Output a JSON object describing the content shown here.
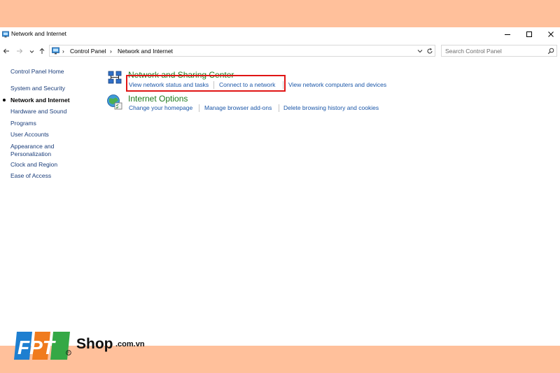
{
  "window": {
    "title": "Network and Internet"
  },
  "address": {
    "crumbs": [
      "Control Panel",
      "Network and Internet"
    ],
    "search_placeholder": "Search Control Panel"
  },
  "sidebar": {
    "home": "Control Panel Home",
    "items": [
      {
        "label": "System and Security"
      },
      {
        "label": "Network and Internet",
        "current": true
      },
      {
        "label": "Hardware and Sound"
      },
      {
        "label": "Programs"
      },
      {
        "label": "User Accounts"
      },
      {
        "label": "Appearance and\nPersonalization"
      },
      {
        "label": "Clock and Region"
      },
      {
        "label": "Ease of Access"
      }
    ]
  },
  "categories": [
    {
      "title": "Network and Sharing Center",
      "icon": "network-sharing-icon",
      "tasks": [
        "View network status and tasks",
        "Connect to a network",
        "View network computers and devices"
      ]
    },
    {
      "title": "Internet Options",
      "icon": "internet-options-icon",
      "tasks": [
        "Change your homepage",
        "Manage browser add-ons",
        "Delete browsing history and cookies"
      ]
    }
  ],
  "watermark": {
    "brand": "FPT",
    "shop": "Shop",
    "domain": ".com.vn"
  },
  "colors": {
    "background": "#ffc09b",
    "category_title": "#1e7a1e",
    "link": "#1a56a8",
    "highlight": "#e01515"
  }
}
